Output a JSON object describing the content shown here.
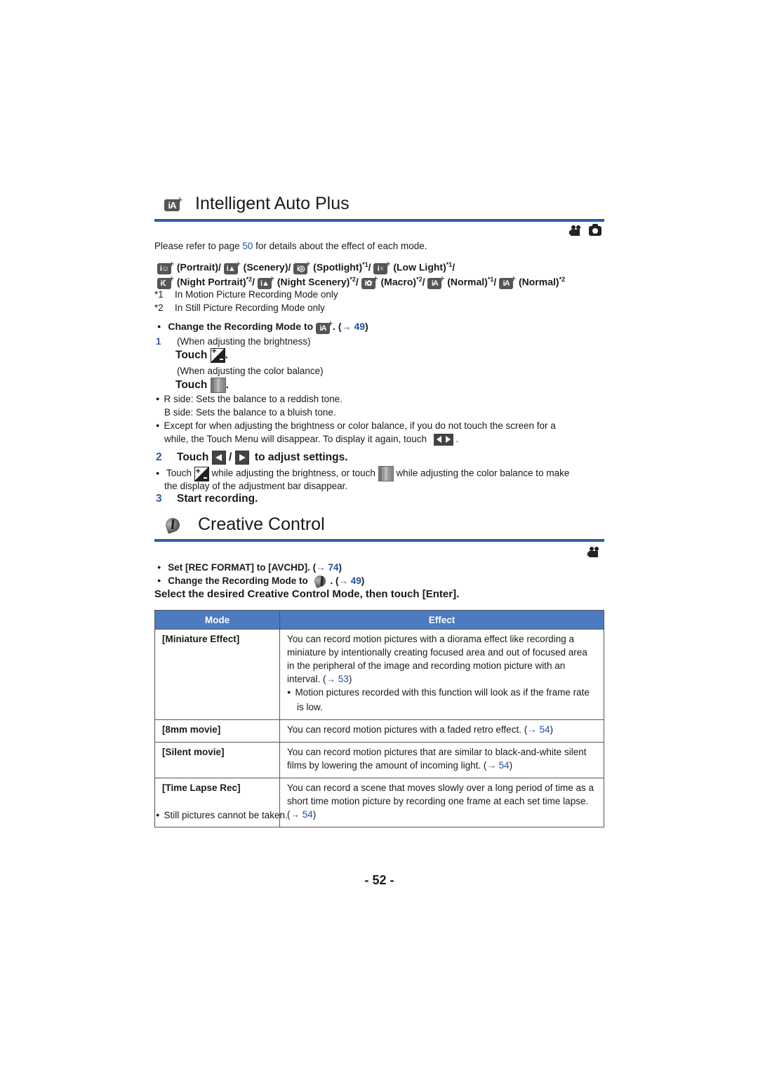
{
  "section1": {
    "title": "Intelligent Auto Plus",
    "icon": "intelligent-auto-plus-icon",
    "mode_icons": [
      "motion-picture-icon",
      "still-picture-icon"
    ],
    "refer_pre": "Please refer to page ",
    "refer_link": "50",
    "refer_post": " for details about the effect of each mode.",
    "modes_line1": [
      {
        "label": "(Portrait)/",
        "sup": ""
      },
      {
        "label": "(Scenery)/",
        "sup": ""
      },
      {
        "label": "(Spotlight)",
        "sup": "*1"
      },
      {
        "label": "(Low Light)",
        "sup": "*1"
      }
    ],
    "modes_line2": [
      {
        "label": "(Night Portrait)",
        "sup": "*2"
      },
      {
        "label": "(Night Scenery)",
        "sup": "*2"
      },
      {
        "label": "(Macro)",
        "sup": "*2"
      },
      {
        "label": "(Normal)",
        "sup": "*1"
      },
      {
        "label": "(Normal)",
        "sup": "*2"
      }
    ],
    "note1_mark": "*1",
    "note1_text": "In Motion Picture Recording Mode only",
    "note2_mark": "*2",
    "note2_text": "In Still Picture Recording Mode only",
    "change_mode_pre": "Change the Recording Mode to ",
    "change_mode_post": ". (",
    "change_mode_link": "→ 49",
    "change_mode_close": ")",
    "step1_num": "1",
    "step1_note_a": "(When adjusting the brightness)",
    "step1_touch_a": "Touch",
    "step1_note_b": "(When adjusting the color balance)",
    "step1_touch_b": "Touch",
    "period": ".",
    "r_side": "R side: Sets the balance to a reddish tone.",
    "b_side": "B side: Sets the balance to a bluish tone.",
    "except_line1": "Except for when adjusting the brightness or color balance, if you do not touch the screen for a",
    "except_line2": "while, the Touch Menu will disappear. To display it again, touch",
    "step2_num": "2",
    "step2_touch": "Touch",
    "step2_slash": "/",
    "step2_post": "to adjust settings.",
    "touch_note_a": "Touch",
    "touch_note_b": "while adjusting the brightness, or touch",
    "touch_note_c": "while adjusting the color balance to make",
    "touch_note_d": "the display of the adjustment bar disappear.",
    "step3_num": "3",
    "step3_text": "Start recording."
  },
  "section2": {
    "title": "Creative Control",
    "icon": "creative-control-icon",
    "mode_icons": [
      "motion-picture-icon"
    ],
    "set_rec_pre": "Set [REC FORMAT] to [AVCHD]. (",
    "set_rec_link": "→ 74",
    "set_rec_close": ")",
    "change_mode_pre": "Change the Recording Mode to ",
    "change_mode_post": ". (",
    "change_mode_link": "→ 49",
    "change_mode_close": ")",
    "instruction": "Select the desired Creative Control Mode, then touch [Enter].",
    "table": {
      "headers": [
        "Mode",
        "Effect"
      ],
      "rows": [
        {
          "mode": "[Miniature Effect]",
          "effect": "You can record motion pictures with a diorama effect like recording a miniature by intentionally creating focused area and out of focused area in the peripheral of the image and recording motion picture with an interval. (",
          "link": "→ 53",
          "close": ")",
          "bullet": "Motion pictures recorded with this function will look as if the frame rate is low."
        },
        {
          "mode": "[8mm movie]",
          "effect": "You can record motion pictures with a faded retro effect. (",
          "link": "→ 54",
          "close": ")"
        },
        {
          "mode": "[Silent movie]",
          "effect": "You can record motion pictures that are similar to black-and-white silent films by lowering the amount of incoming light. (",
          "link": "→ 54",
          "close": ")"
        },
        {
          "mode": "[Time Lapse Rec]",
          "effect": "You can record a scene that moves slowly over a long period of time as a short time motion picture by recording one frame at each set time lapse. (",
          "link": "→ 54",
          "close": ")"
        }
      ]
    },
    "footnote": "Still pictures cannot be taken."
  },
  "page_number": "- 52 -"
}
